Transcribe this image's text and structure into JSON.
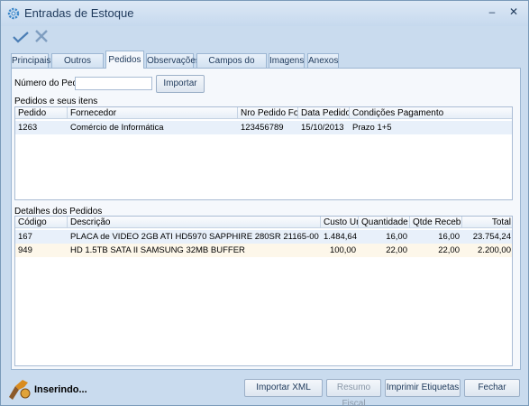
{
  "window": {
    "title": "Entradas de Estoque",
    "minimize": "–",
    "close": "✕"
  },
  "toolbar": {
    "confirm_icon": "check-icon",
    "cancel_icon": "x-icon"
  },
  "tabs": [
    {
      "label": "Principais"
    },
    {
      "label": "Outros Dados"
    },
    {
      "label": "Pedidos"
    },
    {
      "label": "Observações"
    },
    {
      "label": "Campos do Usuário"
    },
    {
      "label": "Imagens"
    },
    {
      "label": "Anexos"
    }
  ],
  "order_search": {
    "label": "Número do Pedido",
    "value": "",
    "import_label": "Importar"
  },
  "orders": {
    "title": "Pedidos e seus itens",
    "columns": [
      "Pedido",
      "Fornecedor",
      "Nro Pedido Forn.",
      "Data Pedido",
      "Condições Pagamento"
    ],
    "rows": [
      {
        "pedido": "1263",
        "fornecedor": "Comércio de Informática",
        "nro": "123456789",
        "data": "15/10/2013",
        "condicoes": "Prazo 1+5"
      }
    ]
  },
  "details": {
    "title": "Detalhes dos Pedidos",
    "columns": [
      "Código",
      "Descrição",
      "Custo Un.",
      "Quantidade",
      "Qtde Recebida",
      "Total"
    ],
    "rows": [
      {
        "codigo": "167",
        "descricao": "PLACA de VIDEO 2GB ATI HD5970 SAPPHIRE 280SR 21165-00",
        "custo": "1.484,64",
        "quantidade": "16,00",
        "recebida": "16,00",
        "total": "23.754,24"
      },
      {
        "codigo": "949",
        "descricao": "HD 1.5TB SATA II SAMSUNG 32MB BUFFER",
        "custo": "100,00",
        "quantidade": "22,00",
        "recebida": "22,00",
        "total": "2.200,00"
      }
    ]
  },
  "footer": {
    "status": "Inserindo...",
    "import_xml": "Importar XML",
    "fiscal_summary": "Resumo Fiscal",
    "print_labels": "Imprimir Etiquetas",
    "close": "Fechar"
  },
  "colors": {
    "accent": "#1e395b",
    "window_bg": "#c9dbee",
    "row_selected": "#e8f0fa"
  }
}
